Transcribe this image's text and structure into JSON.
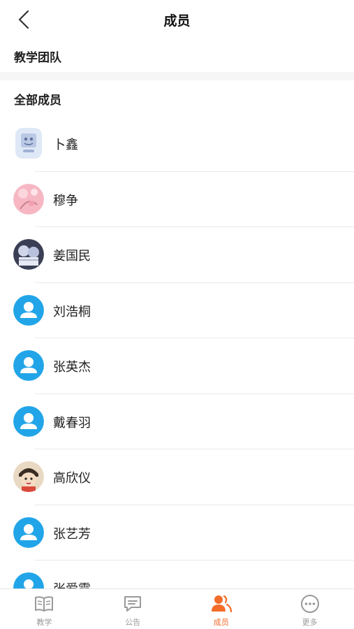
{
  "header": {
    "title": "成员"
  },
  "sections": {
    "teaching_team": "教学团队",
    "all_members": "全部成员"
  },
  "members": [
    {
      "name": "卜鑫",
      "avatar": "custom-image"
    },
    {
      "name": "穆争",
      "avatar": "custom-image"
    },
    {
      "name": "姜国民",
      "avatar": "custom-image"
    },
    {
      "name": "刘浩桐",
      "avatar": "default-person"
    },
    {
      "name": "张英杰",
      "avatar": "default-person"
    },
    {
      "name": "戴春羽",
      "avatar": "default-person"
    },
    {
      "name": "高欣仪",
      "avatar": "custom-image"
    },
    {
      "name": "张艺芳",
      "avatar": "default-person"
    },
    {
      "name": "张爱霞",
      "avatar": "default-person"
    }
  ],
  "tabs": [
    {
      "label": "教学",
      "icon": "book-icon",
      "active": false
    },
    {
      "label": "公告",
      "icon": "message-icon",
      "active": false
    },
    {
      "label": "成员",
      "icon": "members-icon",
      "active": true
    },
    {
      "label": "更多",
      "icon": "more-icon",
      "active": false
    }
  ],
  "colors": {
    "accent": "#f36c2a",
    "avatar_blue": "#22a5e8",
    "inactive": "#999999"
  }
}
